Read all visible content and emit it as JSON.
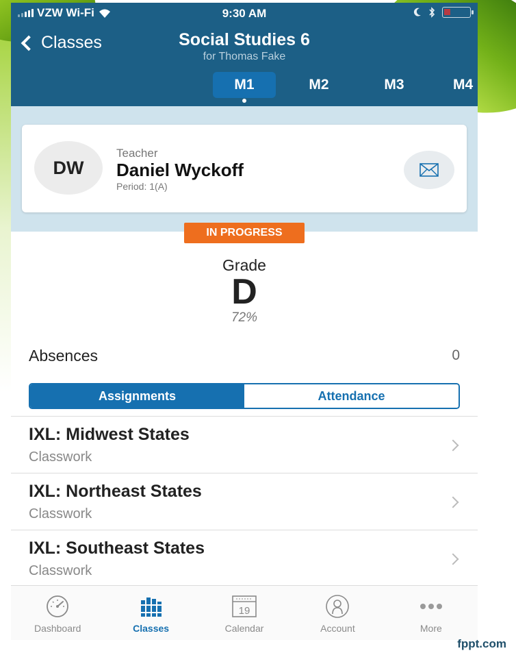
{
  "colors": {
    "header_bg": "#1c5f86",
    "accent": "#1670b0",
    "teacher_zone_bg": "#cfe3ed",
    "status_badge": "#ee6e1e"
  },
  "status_bar": {
    "carrier": "VZW Wi-Fi",
    "time": "9:30 AM"
  },
  "nav": {
    "back_label": "Classes",
    "title": "Social Studies 6",
    "subtitle": "for Thomas Fake"
  },
  "marking_periods": [
    {
      "label": "M1",
      "active": true
    },
    {
      "label": "M2",
      "active": false
    },
    {
      "label": "M3",
      "active": false
    },
    {
      "label": "M4",
      "active": false
    }
  ],
  "teacher": {
    "initials": "DW",
    "role": "Teacher",
    "name": "Daniel Wyckoff",
    "period": "Period: 1(A)",
    "contact_icon": "mail-icon"
  },
  "status": "IN PROGRESS",
  "grade": {
    "label": "Grade",
    "letter": "D",
    "percent": "72%"
  },
  "absences": {
    "label": "Absences",
    "count": "0"
  },
  "segments": {
    "assignments_label": "Assignments",
    "attendance_label": "Attendance",
    "active": "Assignments"
  },
  "assignments": [
    {
      "title": "IXL: Midwest States",
      "type": "Classwork"
    },
    {
      "title": "IXL: Northeast States",
      "type": "Classwork"
    },
    {
      "title": "IXL: Southeast States",
      "type": "Classwork"
    }
  ],
  "tabbar": [
    {
      "label": "Dashboard",
      "icon": "dashboard-gauge-icon",
      "active": false
    },
    {
      "label": "Classes",
      "icon": "books-icon",
      "active": true
    },
    {
      "label": "Calendar",
      "icon": "calendar-icon",
      "active": false,
      "icon_text": "19"
    },
    {
      "label": "Account",
      "icon": "account-person-icon",
      "active": false
    },
    {
      "label": "More",
      "icon": "more-dots-icon",
      "active": false
    }
  ],
  "footer_brand": "fppt.com"
}
